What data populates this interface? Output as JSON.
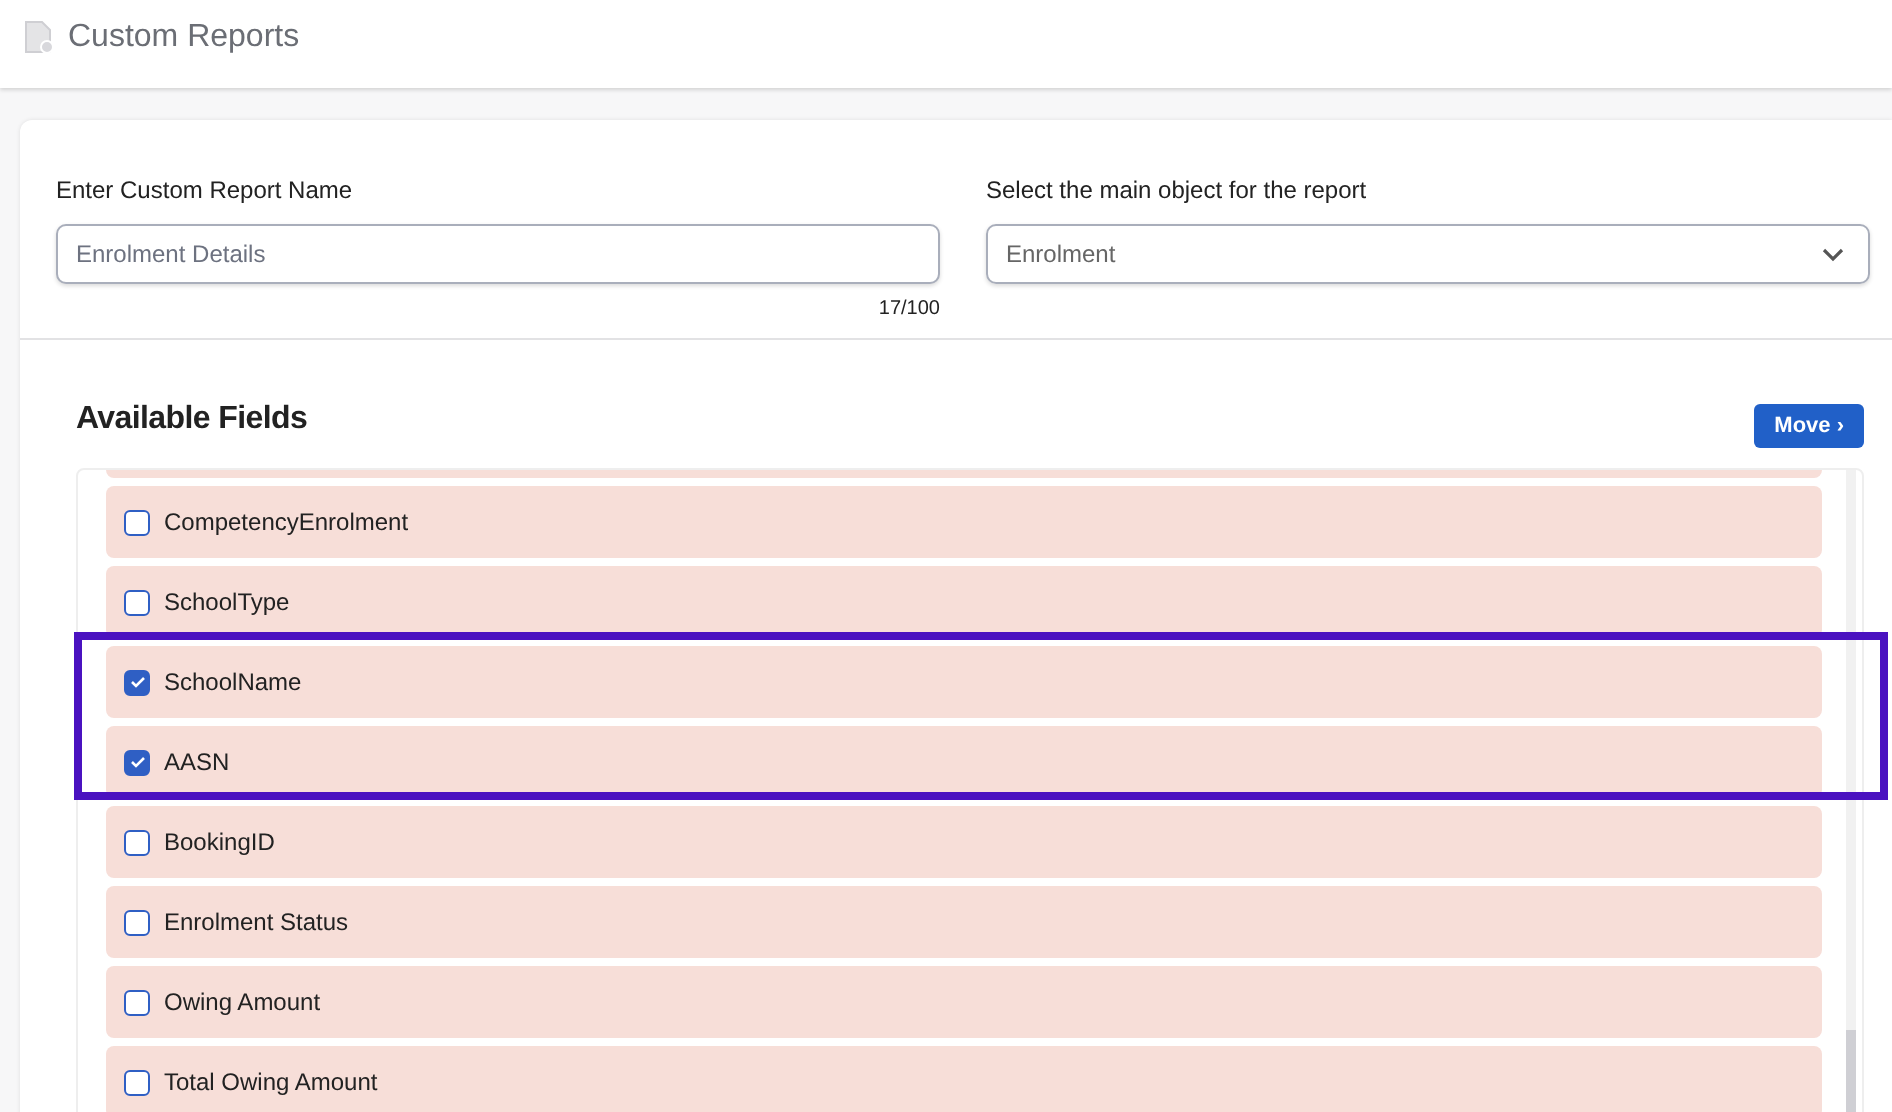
{
  "header": {
    "title": "Custom Reports"
  },
  "report_name": {
    "label": "Enter Custom Report Name",
    "placeholder": "Enrolment Details",
    "counter": "17/100"
  },
  "main_object": {
    "label": "Select the main object for the report",
    "value": "Enrolment"
  },
  "available_fields": {
    "title": "Available Fields",
    "move_button": "Move ›",
    "items": [
      {
        "label": "CompetencyEnrolment",
        "checked": false,
        "highlighted": false
      },
      {
        "label": "SchoolType",
        "checked": false,
        "highlighted": false
      },
      {
        "label": "SchoolName",
        "checked": true,
        "highlighted": true
      },
      {
        "label": "AASN",
        "checked": true,
        "highlighted": true
      },
      {
        "label": "BookingID",
        "checked": false,
        "highlighted": false
      },
      {
        "label": "Enrolment Status",
        "checked": false,
        "highlighted": false
      },
      {
        "label": "Owing Amount",
        "checked": false,
        "highlighted": false
      },
      {
        "label": "Total Owing Amount",
        "checked": false,
        "highlighted": false
      }
    ]
  }
}
